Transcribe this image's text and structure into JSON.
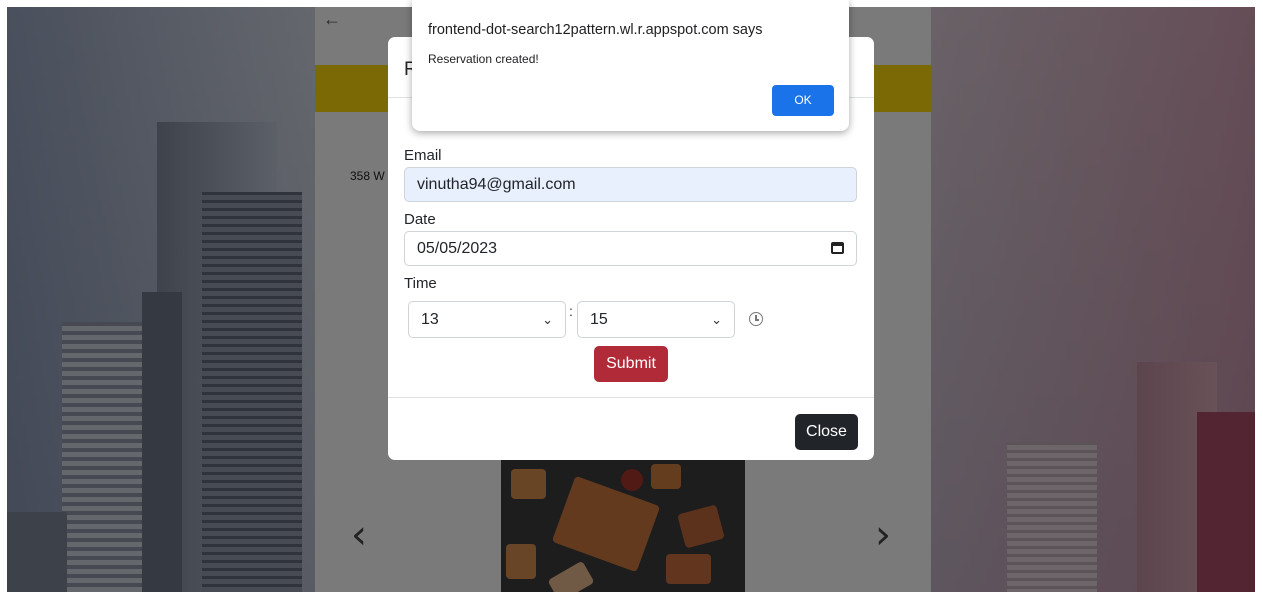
{
  "page": {
    "back_arrow": "←",
    "address_fragment": "358 W",
    "carousel": {
      "prev": "‹",
      "next": "›"
    }
  },
  "modal": {
    "title_fragment": "R",
    "email": {
      "label": "Email",
      "value": "vinutha94@gmail.com"
    },
    "date": {
      "label": "Date",
      "value": "05/05/2023"
    },
    "time": {
      "label": "Time",
      "hour": "13",
      "separator": ":",
      "minute": "15"
    },
    "submit_label": "Submit",
    "close_label": "Close"
  },
  "alert": {
    "title": "frontend-dot-search12pattern.wl.r.appspot.com says",
    "message": "Reservation created!",
    "ok_label": "OK"
  },
  "colors": {
    "primary": "#1a73e8",
    "submit": "#b02a37",
    "accent_bar": "#f5d20a",
    "close": "#212529"
  }
}
